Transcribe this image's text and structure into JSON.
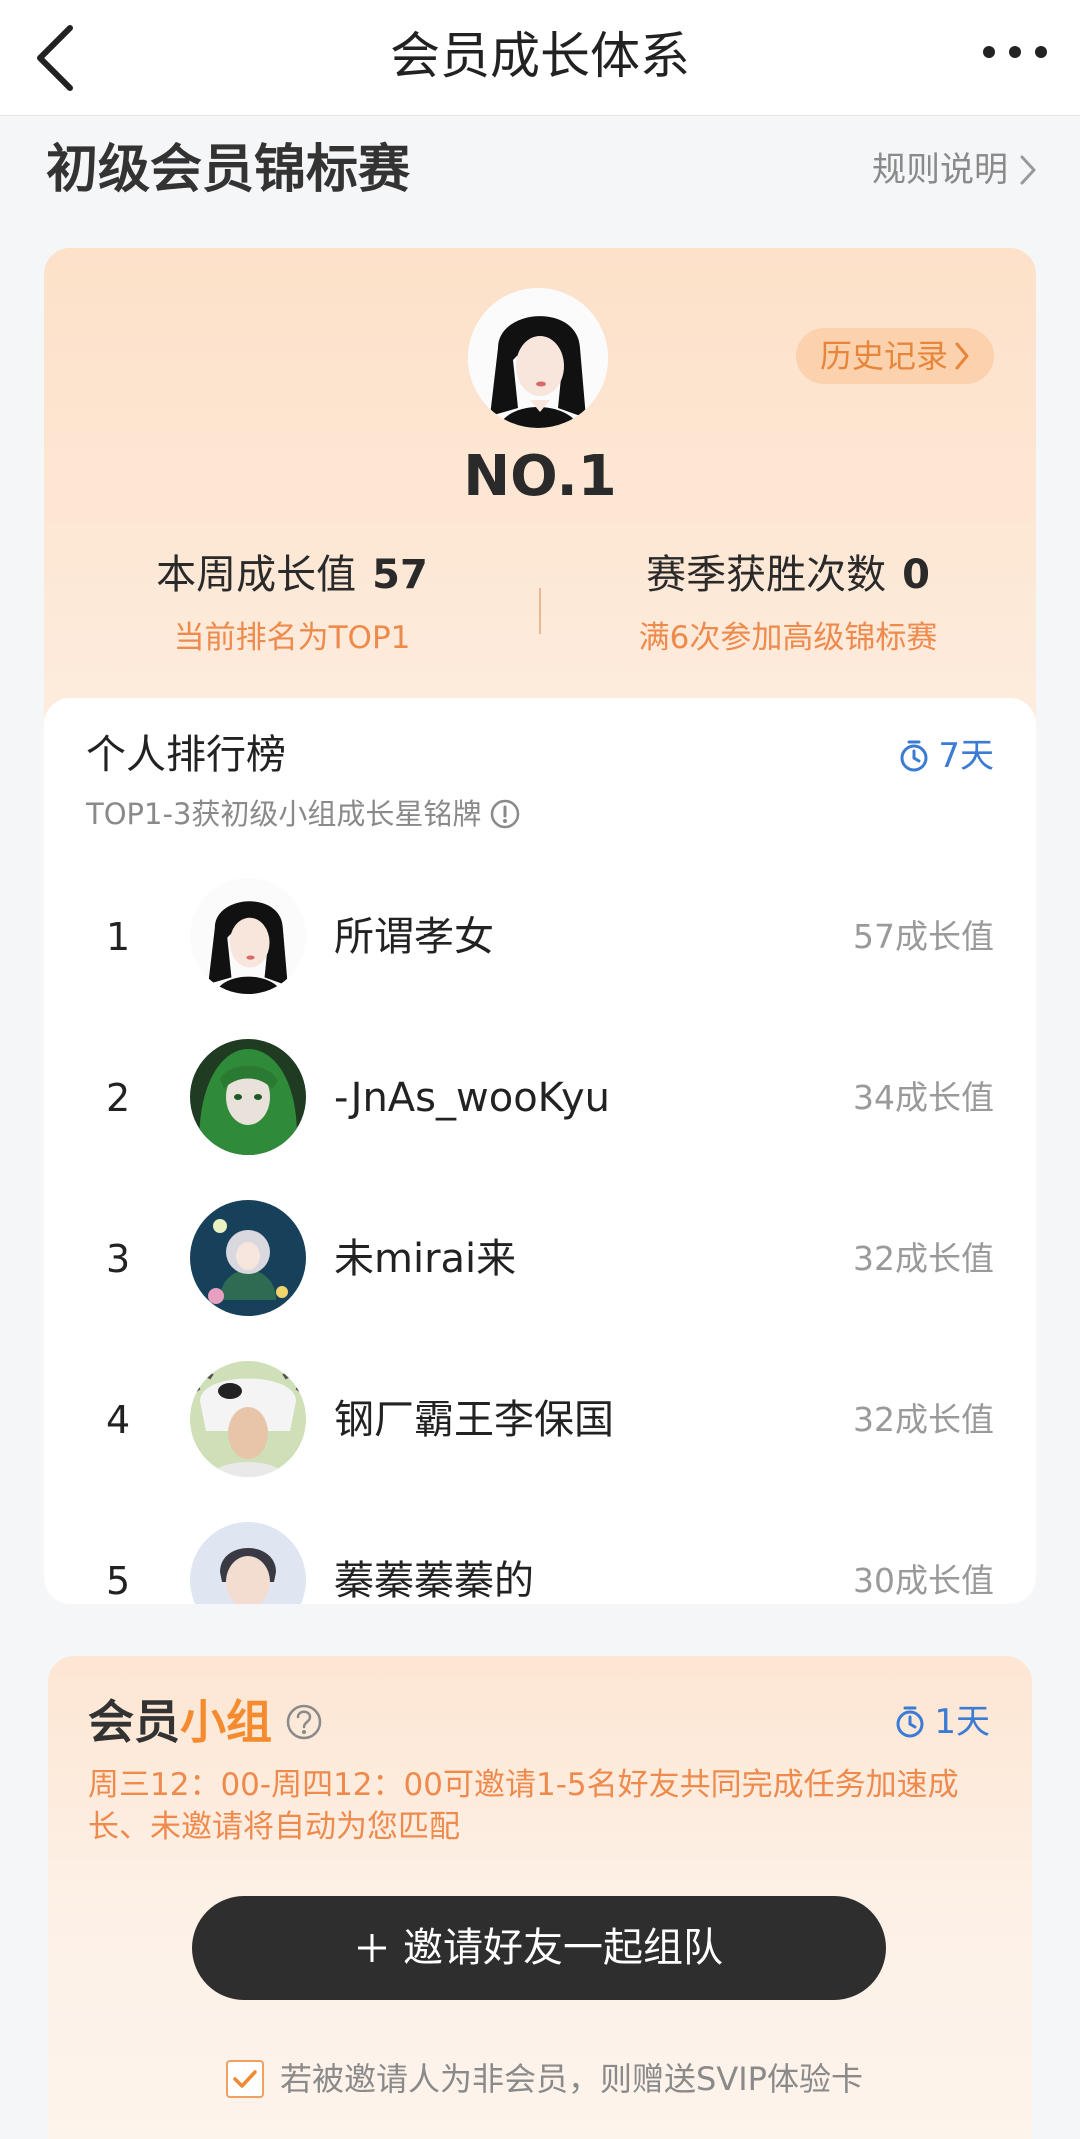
{
  "header": {
    "title": "会员成长体系"
  },
  "section": {
    "title": "初级会员锦标赛",
    "rules_label": "规则说明"
  },
  "summary": {
    "history_label": "历史记录",
    "rank": "NO.1",
    "growth": {
      "label": "本周成长值",
      "value": "57",
      "sub": "当前排名为TOP1"
    },
    "wins": {
      "label": "赛季获胜次数",
      "value": "0",
      "sub": "满6次参加高级锦标赛"
    }
  },
  "leaderboard": {
    "title": "个人排行榜",
    "timer": "7天",
    "subtitle": "TOP1-3获初级小组成长星铭牌",
    "rows": [
      {
        "rank": "1",
        "name": "所谓孝女",
        "score": "57成长值"
      },
      {
        "rank": "2",
        "name": "-JnAs_wooKyu",
        "score": "34成长值"
      },
      {
        "rank": "3",
        "name": "未mirai来",
        "score": "32成长值"
      },
      {
        "rank": "4",
        "name": "钢厂霸王李保国",
        "score": "32成长值"
      },
      {
        "rank": "5",
        "name": "蓁蓁蓁蓁的",
        "score": "30成长值"
      }
    ]
  },
  "group": {
    "title_part1": "会员",
    "title_part2": "小组",
    "timer": "1天",
    "description": "周三12：00-周四12：00可邀请1-5名好友共同完成任务加速成长、未邀请将自动为您匹配",
    "invite_label": "邀请好友一起组队",
    "checkbox_label": "若被邀请人为非会员，则赠送SVIP体验卡",
    "checkbox_checked": true
  },
  "colors": {
    "accent_orange": "#ef8a4d",
    "timer_blue": "#3c7bd4",
    "button_dark": "#2e2e2e"
  }
}
